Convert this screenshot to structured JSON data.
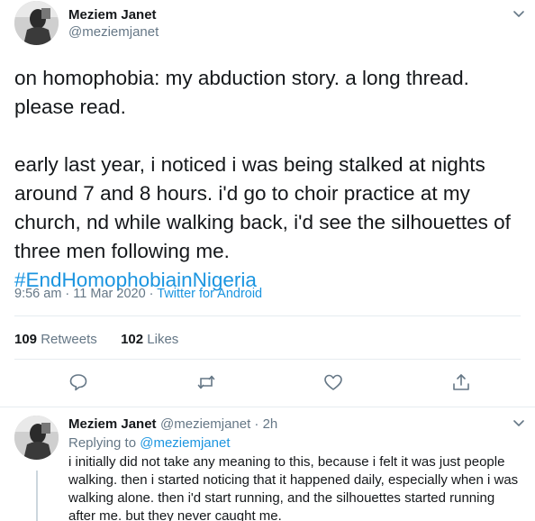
{
  "main_tweet": {
    "author_name": "Meziem Janet",
    "author_handle": "@meziemjanet",
    "text_lines": [
      "on homophobia: my abduction story. a long thread.",
      "please read.",
      "",
      "early last year, i noticed i was being stalked at nights",
      "around 7 and 8 hours. i'd go to choir practice at my",
      "church, nd while walking back, i'd see the silhouettes of",
      "three men following me."
    ],
    "hashtag": "#EndHomophobiainNigeria",
    "time": "9:56 am",
    "date": "11 Mar 2020",
    "separator": " · ",
    "source": "Twitter for Android",
    "retweets_count": "109",
    "retweets_label": "Retweets",
    "likes_count": "102",
    "likes_label": "Likes"
  },
  "reply_tweet": {
    "author_name": "Meziem Janet",
    "handle_and_time": "@meziemjanet · 2h",
    "replying_prefix": "Replying to ",
    "replying_to": "@meziemjanet",
    "text_lines": [
      "i initially did not take any meaning to this, because i felt it was just people",
      "walking. then i started noticing that it happened daily, especially when i was",
      "walking alone. then i'd start running, and the silhouettes started running",
      "after me. but they never caught me."
    ]
  },
  "icons": {
    "reply": "speech-bubble-icon",
    "retweet": "retweet-arrows-icon",
    "like": "heart-icon",
    "share": "share-upload-icon",
    "caret": "chevron-down-icon"
  },
  "colors": {
    "link": "#1b95e0",
    "secondary_text": "#657786",
    "primary_text": "#14171a",
    "divider": "#e6ecf0"
  }
}
